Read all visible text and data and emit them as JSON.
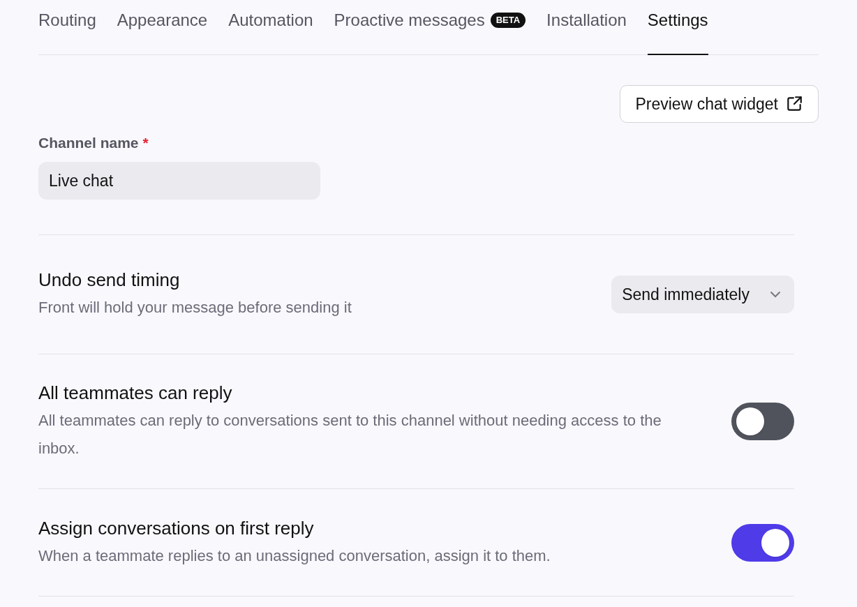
{
  "tabs": [
    {
      "label": "Routing",
      "selected": false
    },
    {
      "label": "Appearance",
      "selected": false
    },
    {
      "label": "Automation",
      "selected": false
    },
    {
      "label": "Proactive messages",
      "badge": "BETA",
      "selected": false
    },
    {
      "label": "Installation",
      "selected": false
    },
    {
      "label": "Settings",
      "selected": true
    }
  ],
  "preview_button": {
    "label": "Preview chat widget"
  },
  "channel_name": {
    "label": "Channel name",
    "required_mark": "*",
    "value": "Live chat"
  },
  "settings": [
    {
      "kind": "select",
      "title": "Undo send timing",
      "description": "Front will hold your message before sending it",
      "value": "Send immediately"
    },
    {
      "kind": "toggle",
      "title": "All teammates can reply",
      "description": "All teammates can reply to conversations sent to this channel without needing access to the inbox.",
      "on": false
    },
    {
      "kind": "toggle",
      "title": "Assign conversations on first reply",
      "description": "When a teammate replies to an unassigned conversation, assign it to them.",
      "on": true
    }
  ]
}
